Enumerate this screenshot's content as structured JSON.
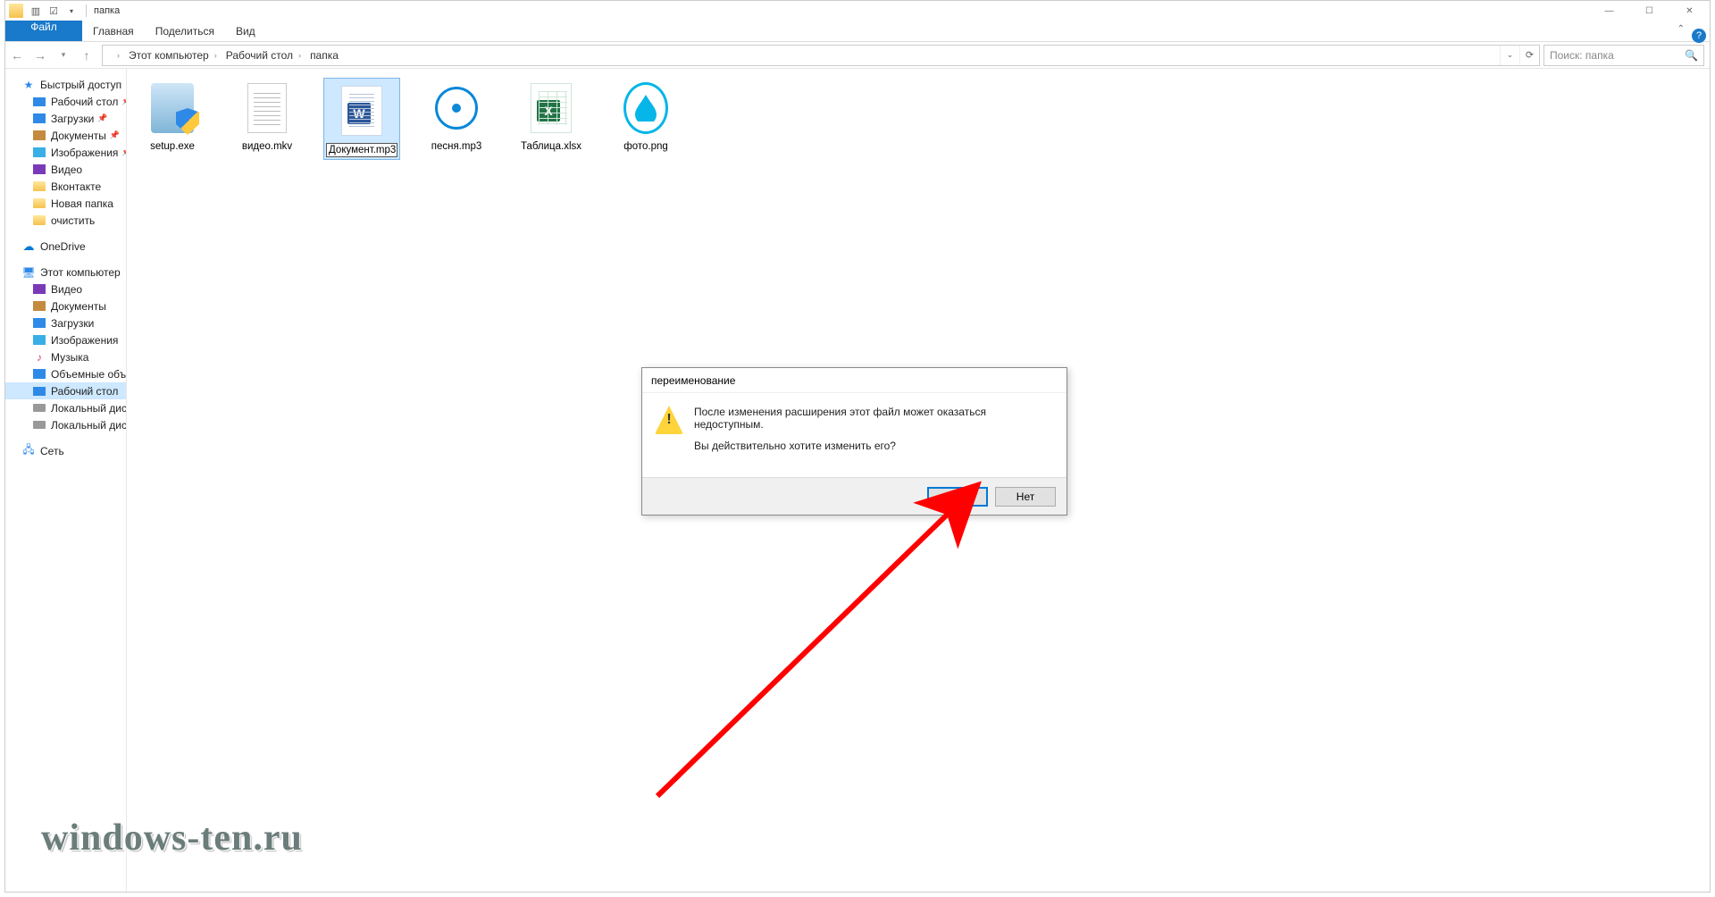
{
  "window": {
    "title": "папка",
    "min": "—",
    "max": "☐",
    "close": "✕"
  },
  "ribbon": {
    "file": "Файл",
    "home": "Главная",
    "share": "Поделиться",
    "view": "Вид"
  },
  "address": {
    "back": "←",
    "forward": "→",
    "up": "↑",
    "crumbs": [
      "Этот компьютер",
      "Рабочий стол",
      "папка"
    ],
    "search_placeholder": "Поиск: папка"
  },
  "sidebar": {
    "quick": {
      "label": "Быстрый доступ",
      "items": [
        {
          "label": "Рабочий стол",
          "icon": "desktop"
        },
        {
          "label": "Загрузки",
          "icon": "blue"
        },
        {
          "label": "Документы",
          "icon": "doc"
        },
        {
          "label": "Изображения",
          "icon": "pic"
        },
        {
          "label": "Видео",
          "icon": "vid"
        },
        {
          "label": "Вконтакте",
          "icon": "folder"
        },
        {
          "label": "Новая папка",
          "icon": "folder"
        },
        {
          "label": "очистить",
          "icon": "folder"
        }
      ]
    },
    "onedrive": "OneDrive",
    "thispc": {
      "label": "Этот компьютер",
      "items": [
        {
          "label": "Видео",
          "icon": "vid"
        },
        {
          "label": "Документы",
          "icon": "doc"
        },
        {
          "label": "Загрузки",
          "icon": "blue"
        },
        {
          "label": "Изображения",
          "icon": "pic"
        },
        {
          "label": "Музыка",
          "icon": "music"
        },
        {
          "label": "Объемные объект",
          "icon": "blue"
        },
        {
          "label": "Рабочий стол",
          "icon": "desktop",
          "selected": true
        },
        {
          "label": "Локальный диск (C",
          "icon": "drive"
        },
        {
          "label": "Локальный диск (D",
          "icon": "drive"
        }
      ]
    },
    "network": "Сеть"
  },
  "files": [
    {
      "name": "setup.exe",
      "type": "installer"
    },
    {
      "name": "видео.mkv",
      "type": "txt"
    },
    {
      "name": "Документ.mp3",
      "type": "word",
      "selected": true
    },
    {
      "name": "песня.mp3",
      "type": "disc"
    },
    {
      "name": "Таблица.xlsx",
      "type": "excel"
    },
    {
      "name": "фото.png",
      "type": "drop"
    }
  ],
  "dialog": {
    "title": "переименование",
    "line1": "После изменения расширения этот файл может оказаться недоступным.",
    "line2": "Вы действительно хотите изменить его?",
    "yes": "Да",
    "no": "Нет"
  },
  "watermark": "windows-ten.ru"
}
